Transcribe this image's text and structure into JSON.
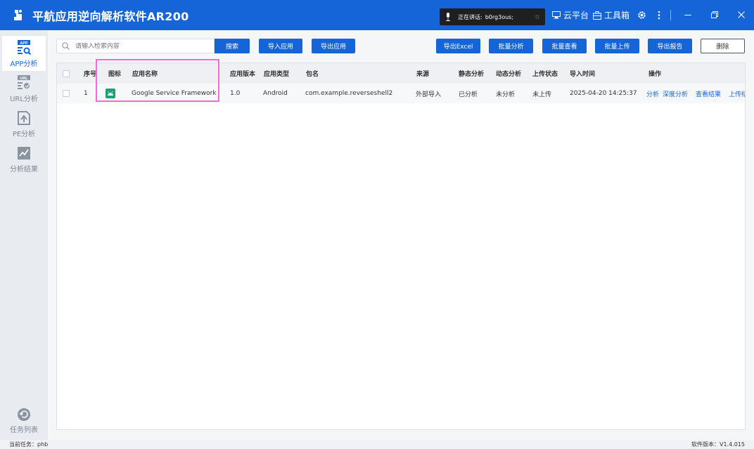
{
  "window": {
    "title": "平航应用逆向解析软件AR200",
    "speaking_label": "正在讲话:",
    "speaking_user": "b0rg3ous;",
    "cloud_label": "云平台",
    "toolbox_label": "工具箱"
  },
  "sidebar": {
    "items": [
      {
        "badge": "APP",
        "label": "APP分析"
      },
      {
        "badge": "URL",
        "label": "URL分析"
      },
      {
        "label": "PE分析"
      },
      {
        "label": "分析结果"
      }
    ],
    "bottom_label": "任务列表"
  },
  "toolbar": {
    "search_placeholder": "请输入检索内容",
    "search_label": "搜索",
    "import_label": "导入应用",
    "export_app_label": "导出应用",
    "export_excel_label": "导出Excel",
    "batch_analyze_label": "批量分析",
    "batch_view_label": "批量查看",
    "batch_upload_label": "批量上传",
    "export_report_label": "导出报告",
    "delete_label": "删除"
  },
  "table": {
    "headers": {
      "index": "序号",
      "icon": "图标",
      "name": "应用名称",
      "version": "应用版本",
      "type": "应用类型",
      "package": "包名",
      "source": "来源",
      "static": "静态分析",
      "dynamic": "动态分析",
      "upload": "上传状态",
      "import_time": "导入时间",
      "actions": "操作"
    },
    "rows": [
      {
        "index": "1",
        "name": "Google Service Framework",
        "version": "1.0",
        "type": "Android",
        "package": "com.example.reverseshell2",
        "source": "外部导入",
        "static": "已分析",
        "dynamic": "未分析",
        "upload": "未上传",
        "import_time": "2025-04-20 14:25:37",
        "actions": [
          "分析",
          "深度分析",
          "查看结果",
          "上传结"
        ]
      }
    ]
  },
  "status": {
    "task": "当前任务：phb",
    "version": "软件版本：V1.4.015"
  },
  "colors": {
    "primary": "#1565d8",
    "analyzed": "#2bb24c",
    "highlight": "#f06ad8"
  }
}
